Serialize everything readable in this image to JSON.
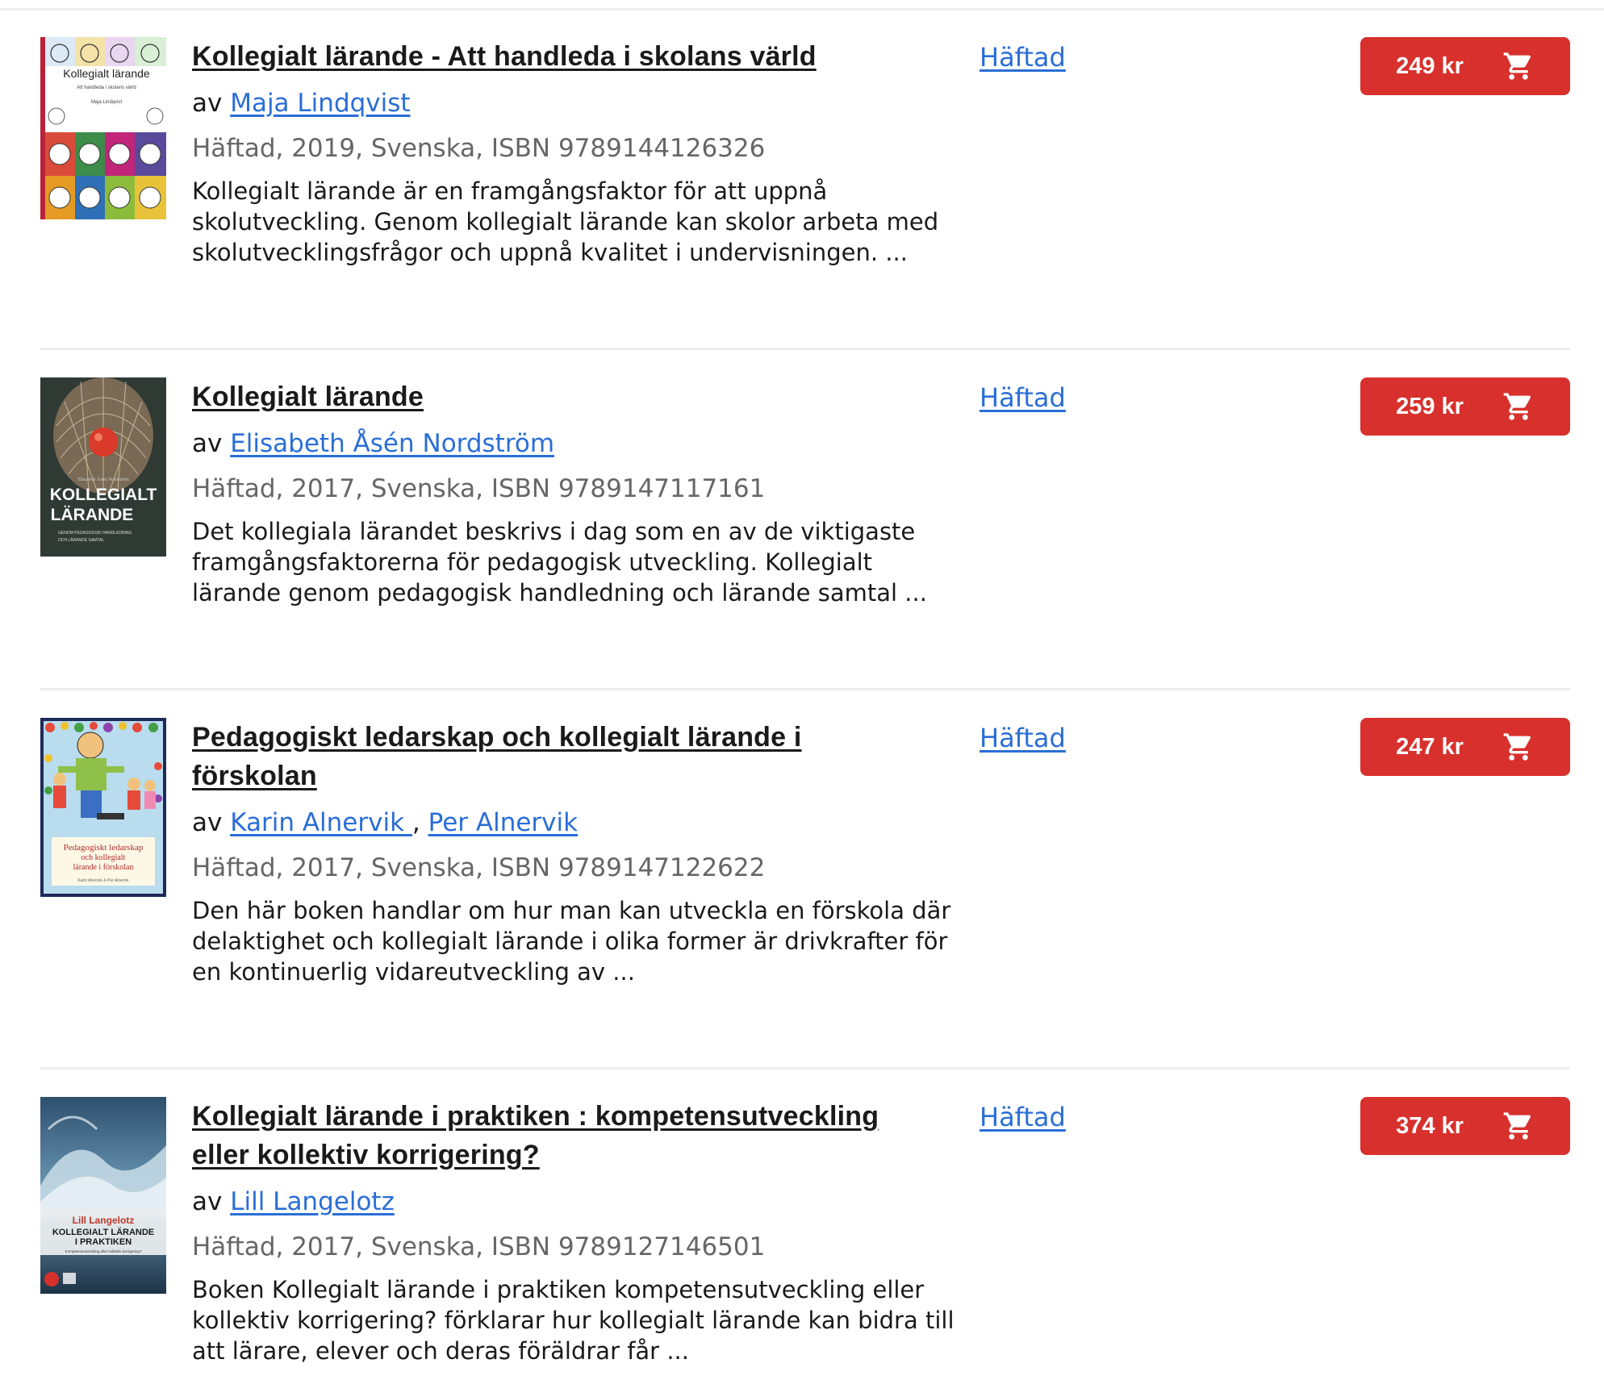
{
  "products": [
    {
      "title": "Kollegialt lärande - Att handleda i skolans värld",
      "by": "av",
      "authors": [
        "Maja Lindqvist"
      ],
      "meta": "Häftad, 2019, Svenska, ISBN 9789144126326",
      "description": "Kollegialt lärande är en framgångsfaktor för att uppnå skolutveckling. Genom kollegialt lärande kan skolor arbeta med skolutvecklingsfrågor och uppnå kvalitet i undervisningen. ...",
      "format": "Häftad",
      "price": "249 kr",
      "cover": {
        "title": "Kollegialt lärande",
        "subtitle": "Att handleda i skolans värld",
        "author": "Maja Lindqvist"
      }
    },
    {
      "title": "Kollegialt lärande",
      "by": "av",
      "authors": [
        "Elisabeth Åsén Nordström"
      ],
      "meta": "Häftad, 2017, Svenska, ISBN 9789147117161",
      "description": "Det kollegiala lärandet beskrivs i dag som en av de viktigaste framgångsfaktorerna för pedagogisk utveckling. Kollegialt lärande genom pedagogisk handledning och lärande samtal ...",
      "format": "Häftad",
      "price": "259 kr",
      "cover": {
        "author": "Elisabeth Åsén Nordström",
        "title_line1": "KOLLEGIALT",
        "title_line2": "LÄRANDE",
        "subtitle_line1": "GENOM PEDAGOGISK HANDLEDNING",
        "subtitle_line2": "OCH LÄRANDE SAMTAL"
      }
    },
    {
      "title": "Pedagogiskt ledarskap och kollegialt lärande i förskolan",
      "by": "av",
      "authors": [
        "Karin Alnervik ",
        "Per Alnervik"
      ],
      "author_separator": ",",
      "meta": "Häftad, 2017, Svenska, ISBN 9789147122622",
      "description": "Den här boken handlar om hur man kan utveckla en förskola där delaktighet och kollegialt lärande i olika former är drivkrafter för en kontinuerlig vidareutveckling av ...",
      "format": "Häftad",
      "price": "247 kr",
      "cover": {
        "line1": "Pedagogiskt ledarskap",
        "line2": "och kollegialt",
        "line3": "lärande i förskolan",
        "author": "Karin Alnervik & Per Alnervik"
      }
    },
    {
      "title": "Kollegialt lärande i praktiken : kompetensutveckling eller kollektiv korrigering?",
      "by": "av",
      "authors": [
        "Lill Langelotz"
      ],
      "meta": "Häftad, 2017, Svenska, ISBN 9789127146501",
      "description": "Boken Kollegialt lärande i praktiken kompetensutveckling eller kollektiv korrigering? förklarar hur kollegialt lärande kan bidra till att lärare, elever och deras föräldrar får ...",
      "format": "Häftad",
      "price": "374 kr",
      "cover": {
        "author": "Lill Langelotz",
        "title_line1": "KOLLEGIALT LÄRANDE",
        "title_line2": "I PRAKTIKEN",
        "subtitle": "Kompetensutveckling eller kollektiv korrigering?"
      }
    }
  ],
  "colors": {
    "accent": "#d8302c",
    "link": "#2a6ed6",
    "meta_text": "#666666",
    "divider": "#ececec"
  },
  "icons": {
    "cart": "shopping-cart-icon"
  }
}
